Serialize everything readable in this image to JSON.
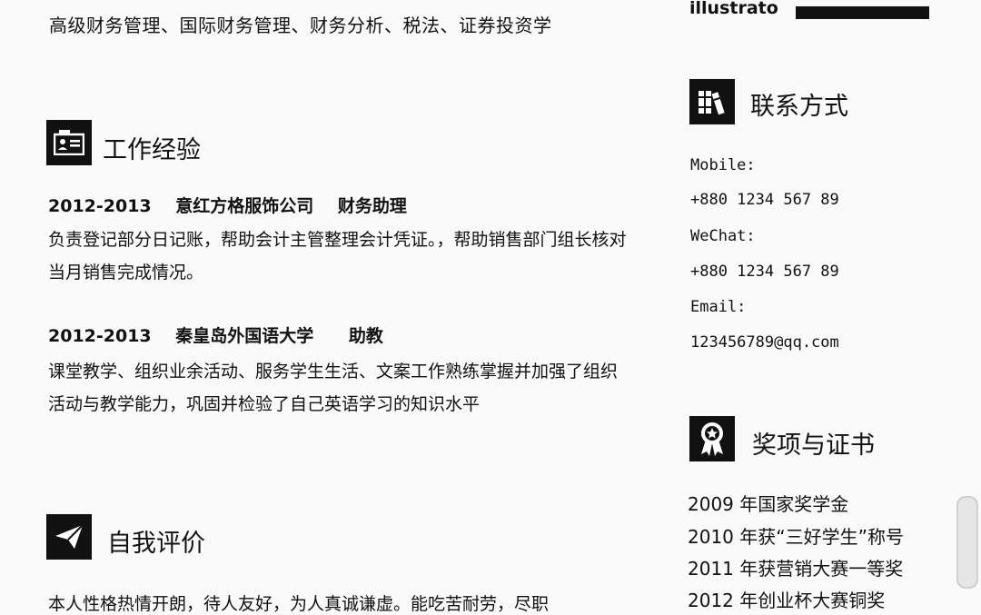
{
  "education": {
    "courses_line": "高级财务管理、国际财务管理、财务分析、税法、证券投资学"
  },
  "work": {
    "title": "工作经验",
    "icon": "id-card-icon",
    "jobs": [
      {
        "period": "2012-2013",
        "company": "意红方格服饰公司",
        "role": "财务助理",
        "desc": "负责登记部分日记账，帮助会计主管整理会计凭证。，帮助销售部门组长核对当月销售完成情况。"
      },
      {
        "period": "2012-2013",
        "company": "秦皇岛外国语大学",
        "role": "助教",
        "desc": "课堂教学、组织业余活动、服务学生生活、文案工作熟练掌握并加强了组织活动与教学能力，巩固并检验了自己英语学习的知识水平"
      }
    ]
  },
  "self_eval": {
    "title": "自我评价",
    "icon": "paper-plane-icon",
    "text": "本人性格热情开朗，待人友好，为人真诚谦虚。能吃苦耐劳，尽职"
  },
  "skills": {
    "name": "illustrato",
    "level": 1.0
  },
  "contact": {
    "title": "联系方式",
    "icon": "books-icon",
    "mobile_label": "Mobile:",
    "mobile": "+880 1234 567 89",
    "wechat_label": "WeChat:",
    "wechat": "+880 1234 567 89",
    "email_label": "Email:",
    "email": "123456789@qq.com"
  },
  "awards": {
    "title": "奖项与证书",
    "icon": "award-ribbon-icon",
    "items": [
      "2009 年国家奖学金",
      "2010 年获“三好学生”称号",
      "2011 年获营销大赛一等奖",
      "2012 年创业杯大赛铜奖"
    ]
  }
}
